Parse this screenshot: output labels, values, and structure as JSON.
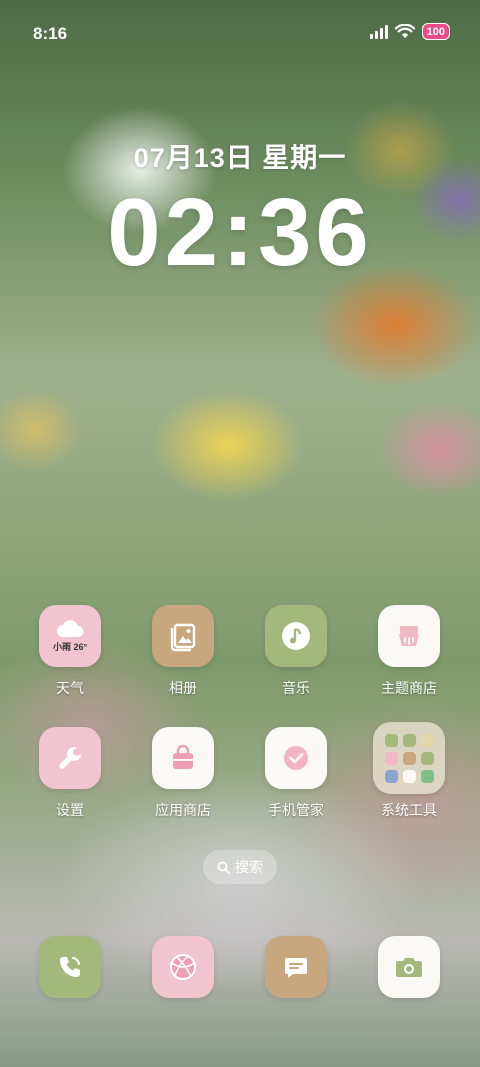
{
  "status_bar": {
    "time": "8:16",
    "battery": "100"
  },
  "lockscreen": {
    "date": "07月13日 星期一",
    "clock": "02:36"
  },
  "weather_widget": {
    "text": "小雨 26°"
  },
  "apps_row1": [
    {
      "label": "天气",
      "icon": "weather-icon"
    },
    {
      "label": "相册",
      "icon": "gallery-icon"
    },
    {
      "label": "音乐",
      "icon": "music-icon"
    },
    {
      "label": "主题商店",
      "icon": "theme-store-icon"
    }
  ],
  "apps_row2": [
    {
      "label": "设置",
      "icon": "settings-icon"
    },
    {
      "label": "应用商店",
      "icon": "app-store-icon"
    },
    {
      "label": "手机管家",
      "icon": "phone-manager-icon"
    },
    {
      "label": "系统工具",
      "icon": "folder-icon"
    }
  ],
  "search": {
    "label": "搜索"
  },
  "dock": [
    {
      "icon": "phone-icon"
    },
    {
      "icon": "browser-icon"
    },
    {
      "icon": "messages-icon"
    },
    {
      "icon": "camera-icon"
    }
  ],
  "colors": {
    "pink": "#f2c4cf",
    "tan": "#c8a77f",
    "green": "#a4b87c",
    "white": "#fbf9f6",
    "battery": "#e84d8a"
  }
}
